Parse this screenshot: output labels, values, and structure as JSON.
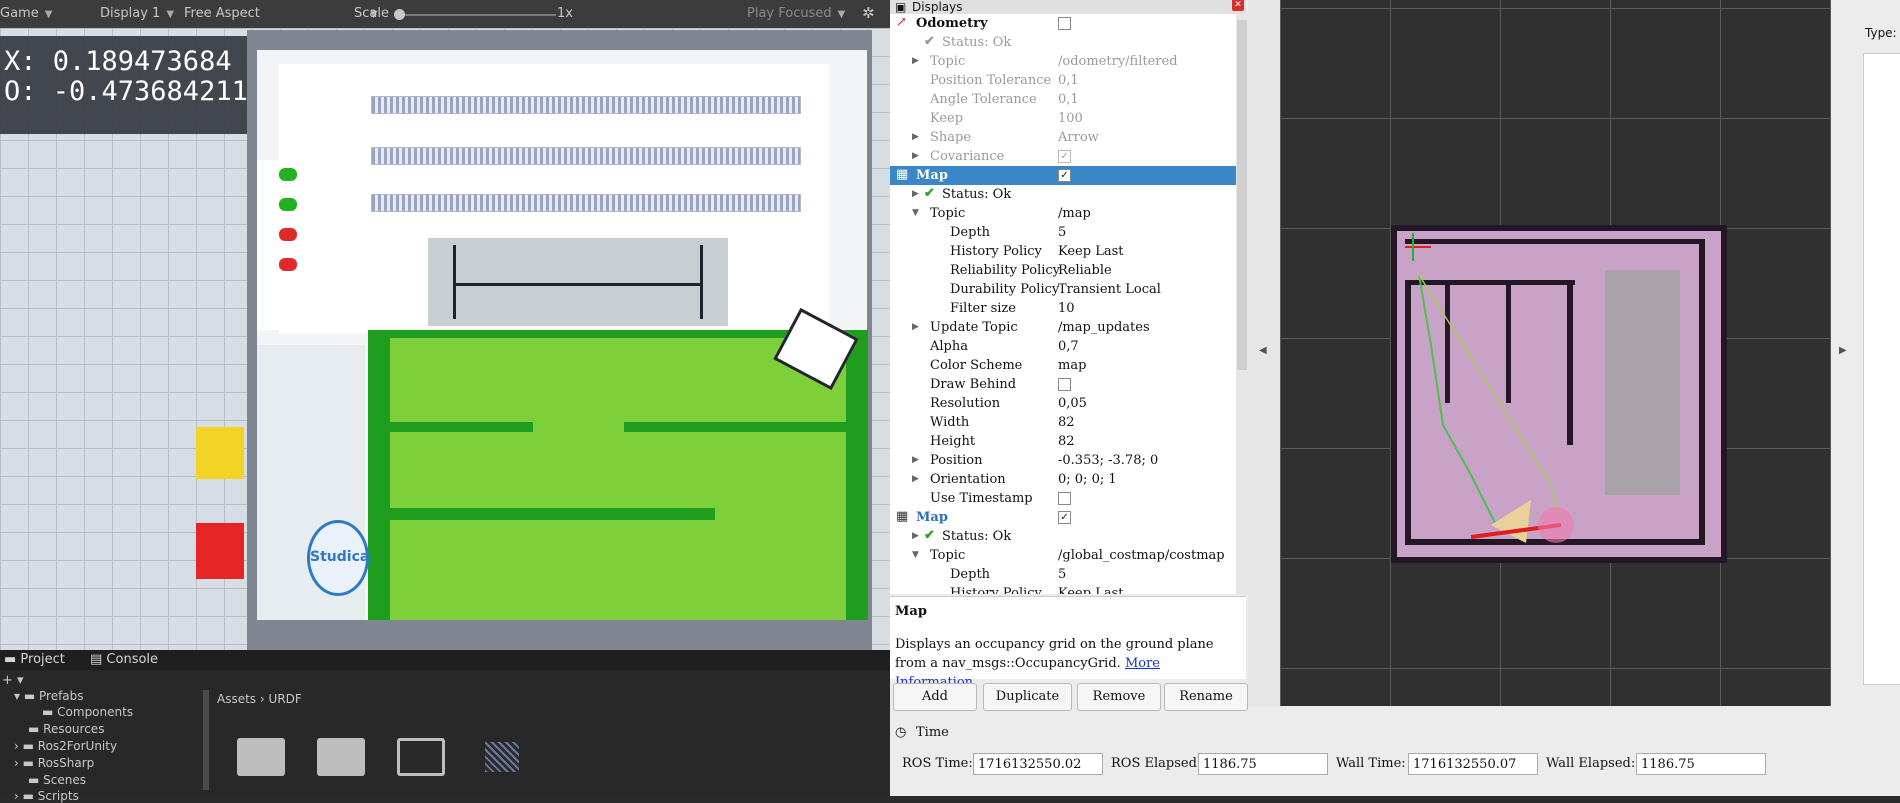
{
  "unity": {
    "toolbar": {
      "game_label": "Game",
      "display_label": "Display 1",
      "aspect_label": "Free Aspect",
      "scale_label": "Scale",
      "scale_value": "1x",
      "play_mode": "Play Focused"
    },
    "overlay": {
      "x_text": "X: 0.189473684",
      "o_text": "O: -0.473684211"
    },
    "logo_text": "Studica",
    "project": {
      "tabs": [
        "Project",
        "Console"
      ],
      "tree": [
        "Prefabs",
        "Components",
        "Resources",
        "Ros2ForUnity",
        "RosSharp",
        "Scenes",
        "Scripts"
      ],
      "breadcrumb_assets": "Assets",
      "breadcrumb_sep": "›",
      "breadcrumb_urdf": "URDF",
      "add_label": "+ ▾"
    }
  },
  "rviz": {
    "displays_title": "Displays",
    "rows": [
      {
        "label": "Odometry",
        "value": "",
        "checkbox": "empty",
        "indent": 0,
        "style": "normal",
        "icon": "odometry-icon"
      },
      {
        "label": "Status: Ok",
        "value": "",
        "indent": 1,
        "style": "dim",
        "icon": "check-icon"
      },
      {
        "label": "Topic",
        "value": "/odometry/filtered",
        "indent": 1,
        "style": "dim",
        "tri": true
      },
      {
        "label": "Position Tolerance",
        "value": "0,1",
        "indent": 1,
        "style": "dim"
      },
      {
        "label": "Angle Tolerance",
        "value": "0,1",
        "indent": 1,
        "style": "dim"
      },
      {
        "label": "Keep",
        "value": "100",
        "indent": 1,
        "style": "dim"
      },
      {
        "label": "Shape",
        "value": "Arrow",
        "indent": 1,
        "style": "dim",
        "tri": true
      },
      {
        "label": "Covariance",
        "value": "",
        "checkbox": "checked-dim",
        "indent": 1,
        "style": "dim",
        "tri": true
      },
      {
        "label": "Map",
        "value": "",
        "checkbox": "checked",
        "indent": 0,
        "style": "sel",
        "icon": "map-icon"
      },
      {
        "label": "Status: Ok",
        "value": "",
        "indent": 1,
        "style": "normal",
        "icon": "check-icon",
        "tri": true
      },
      {
        "label": "Topic",
        "value": "/map",
        "indent": 1,
        "style": "normal",
        "tri": true,
        "open": true
      },
      {
        "label": "Depth",
        "value": "5",
        "indent": 2,
        "style": "normal"
      },
      {
        "label": "History Policy",
        "value": "Keep Last",
        "indent": 2,
        "style": "normal"
      },
      {
        "label": "Reliability Policy",
        "value": "Reliable",
        "indent": 2,
        "style": "normal"
      },
      {
        "label": "Durability Policy",
        "value": "Transient Local",
        "indent": 2,
        "style": "normal"
      },
      {
        "label": "Filter size",
        "value": "10",
        "indent": 2,
        "style": "normal"
      },
      {
        "label": "Update Topic",
        "value": "/map_updates",
        "indent": 1,
        "style": "normal",
        "tri": true
      },
      {
        "label": "Alpha",
        "value": "0,7",
        "indent": 1,
        "style": "normal"
      },
      {
        "label": "Color Scheme",
        "value": "map",
        "indent": 1,
        "style": "normal"
      },
      {
        "label": "Draw Behind",
        "value": "",
        "checkbox": "empty",
        "indent": 1,
        "style": "normal"
      },
      {
        "label": "Resolution",
        "value": "0,05",
        "indent": 1,
        "style": "normal"
      },
      {
        "label": "Width",
        "value": "82",
        "indent": 1,
        "style": "normal"
      },
      {
        "label": "Height",
        "value": "82",
        "indent": 1,
        "style": "normal"
      },
      {
        "label": "Position",
        "value": "-0.353; -3.78; 0",
        "indent": 1,
        "style": "normal",
        "tri": true
      },
      {
        "label": "Orientation",
        "value": "0; 0; 0; 1",
        "indent": 1,
        "style": "normal",
        "tri": true
      },
      {
        "label": "Use Timestamp",
        "value": "",
        "checkbox": "empty",
        "indent": 1,
        "style": "normal"
      },
      {
        "label": "Map",
        "value": "",
        "checkbox": "checked",
        "indent": 0,
        "style": "blue",
        "icon": "map-icon"
      },
      {
        "label": "Status: Ok",
        "value": "",
        "indent": 1,
        "style": "normal",
        "icon": "check-icon",
        "tri": true
      },
      {
        "label": "Topic",
        "value": "/global_costmap/costmap",
        "indent": 1,
        "style": "normal",
        "tri": true,
        "open": true
      },
      {
        "label": "Depth",
        "value": "5",
        "indent": 2,
        "style": "normal"
      },
      {
        "label": "History Policy",
        "value": "Keep Last",
        "indent": 2,
        "style": "normal"
      }
    ],
    "description": {
      "title": "Map",
      "text": "Displays an occupancy grid on the ground plane from a nav_msgs::OccupancyGrid.",
      "link": "More Information"
    },
    "buttons": {
      "add": "Add",
      "duplicate": "Duplicate",
      "remove": "Remove",
      "rename": "Rename"
    },
    "right_panel": {
      "type_label": "Type:"
    },
    "time": {
      "title": "Time",
      "ros_time_label": "ROS Time:",
      "ros_time": "1716132550.02",
      "ros_elapsed_label": "ROS Elapsed:",
      "ros_elapsed": "1186.75",
      "wall_time_label": "Wall Time:",
      "wall_time": "1716132550.07",
      "wall_elapsed_label": "Wall Elapsed:",
      "wall_elapsed": "1186.75"
    }
  }
}
